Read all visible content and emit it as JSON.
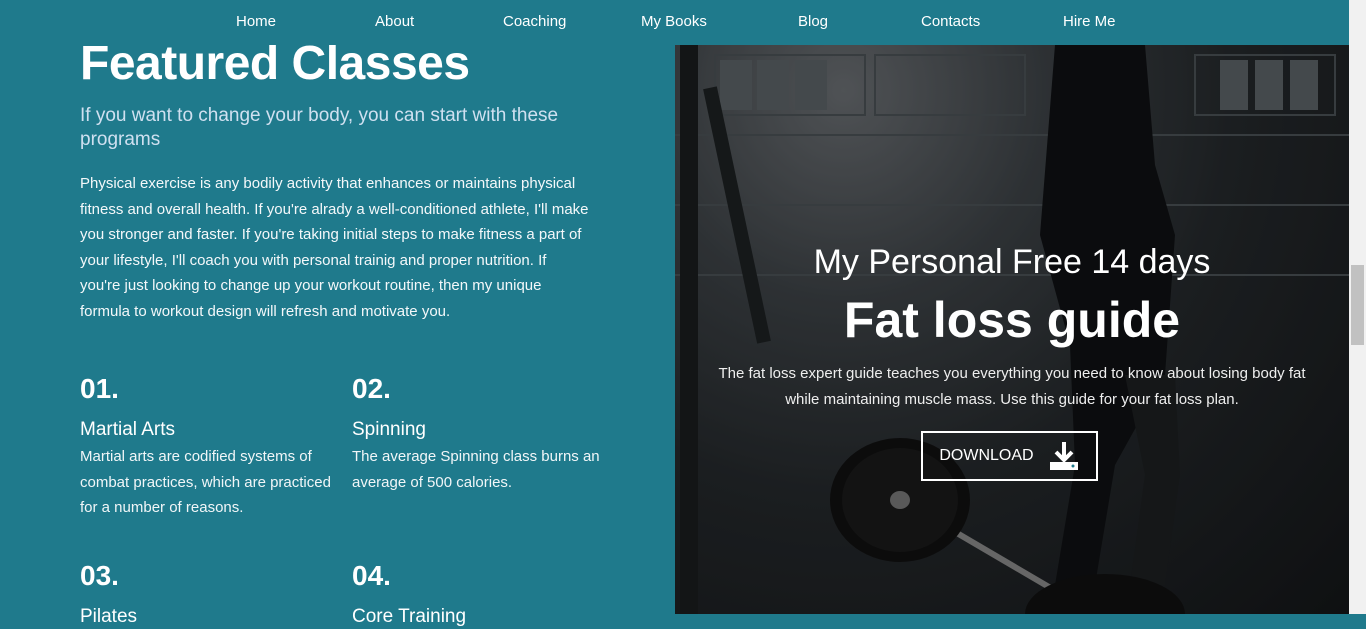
{
  "nav": {
    "items": [
      "Home",
      "About",
      "Coaching",
      "My Books",
      "Blog",
      "Contacts",
      "Hire Me"
    ]
  },
  "featured": {
    "title": "Featured Classes",
    "subtitle": "If you want to change your body, you can start with these programs",
    "intro": "Physical exercise is any bodily activity that enhances or maintains physical fitness and overall health. If you're alrady a well-conditioned athlete, I'll make you stronger and faster. If you're taking initial steps to make fitness a part of your lifestyle, I'll coach you with personal trainig and proper nutrition. If you're just looking to change up your workout routine, then my unique formula to workout design will refresh and motivate you.",
    "classes": [
      {
        "num": "01.",
        "name": "Martial Arts",
        "desc": "Martial arts are codified systems of combat practices, which are practiced for a number of reasons."
      },
      {
        "num": "02.",
        "name": "Spinning",
        "desc": "The average Spinning class burns an average of 500 calories."
      },
      {
        "num": "03.",
        "name": "Pilates",
        "desc": ""
      },
      {
        "num": "04.",
        "name": "Core Training",
        "desc": ""
      }
    ]
  },
  "hero": {
    "subtitle": "My Personal Free 14 days",
    "title": "Fat loss guide",
    "description": "The fat loss expert guide teaches you everything you need to know about losing body fat while maintaining muscle mass. Use this guide for your fat loss plan.",
    "button_label": "DOWNLOAD",
    "button_icon": "download-icon"
  },
  "colors": {
    "background": "#1f7a8c",
    "subtitle": "#cfe0f0",
    "text": "#ffffff"
  }
}
